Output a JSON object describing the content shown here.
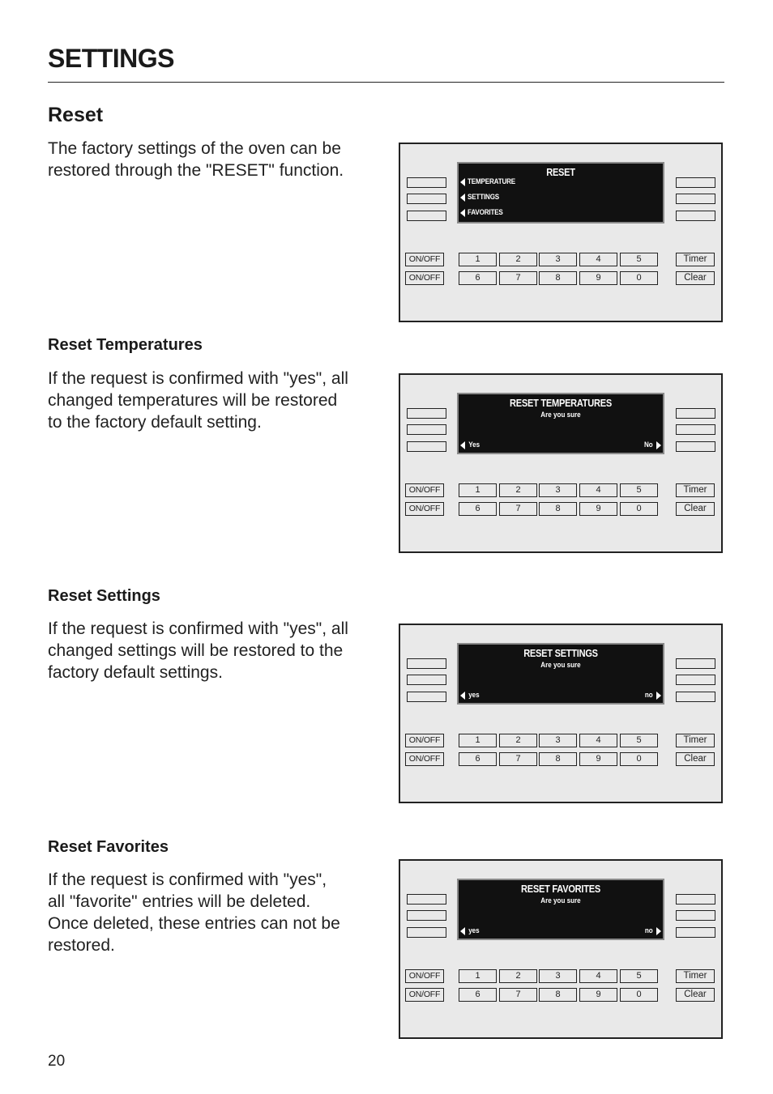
{
  "header": {
    "title": "SETTINGS"
  },
  "sections": [
    {
      "heading": "Reset",
      "paragraph_lines": [
        "The factory settings of the oven can be",
        "restored through the \"RESET\" function."
      ],
      "panel": {
        "display_title": "RESET",
        "display_subtitle": "",
        "menu_items": [
          "TEMPERATURE",
          "SETTINGS",
          "FAVORITES"
        ],
        "option_left": "",
        "option_right": ""
      }
    },
    {
      "heading": "Reset Temperatures",
      "paragraph_lines": [
        "If the request is confirmed with \"yes\", all",
        "changed temperatures will be restored",
        "to the factory default setting."
      ],
      "panel": {
        "display_title": "RESET TEMPERATURES",
        "display_subtitle": "Are you sure",
        "menu_items": [],
        "option_left": "Yes",
        "option_right": "No"
      }
    },
    {
      "heading": "Reset Settings",
      "paragraph_lines": [
        "If the request is confirmed with \"yes\", all",
        "changed settings will be restored to the",
        "factory default settings."
      ],
      "panel": {
        "display_title": "RESET SETTINGS",
        "display_subtitle": "Are you sure",
        "menu_items": [],
        "option_left": "yes",
        "option_right": "no"
      }
    },
    {
      "heading": "Reset Favorites",
      "paragraph_lines": [
        "If the request is confirmed with \"yes\",",
        "all \"favorite\" entries will be deleted.",
        "Once deleted, these entries can not be",
        "restored."
      ],
      "panel": {
        "display_title": "RESET FAVORITES",
        "display_subtitle": "Are you sure",
        "menu_items": [],
        "option_left": "yes",
        "option_right": "no"
      }
    }
  ],
  "keypad": {
    "onoff_label": "ON/OFF",
    "row1": [
      "1",
      "2",
      "3",
      "4",
      "5"
    ],
    "row2": [
      "6",
      "7",
      "8",
      "9",
      "0"
    ],
    "timer_label": "Timer",
    "clear_label": "Clear"
  },
  "footer": {
    "page_number": "20"
  }
}
